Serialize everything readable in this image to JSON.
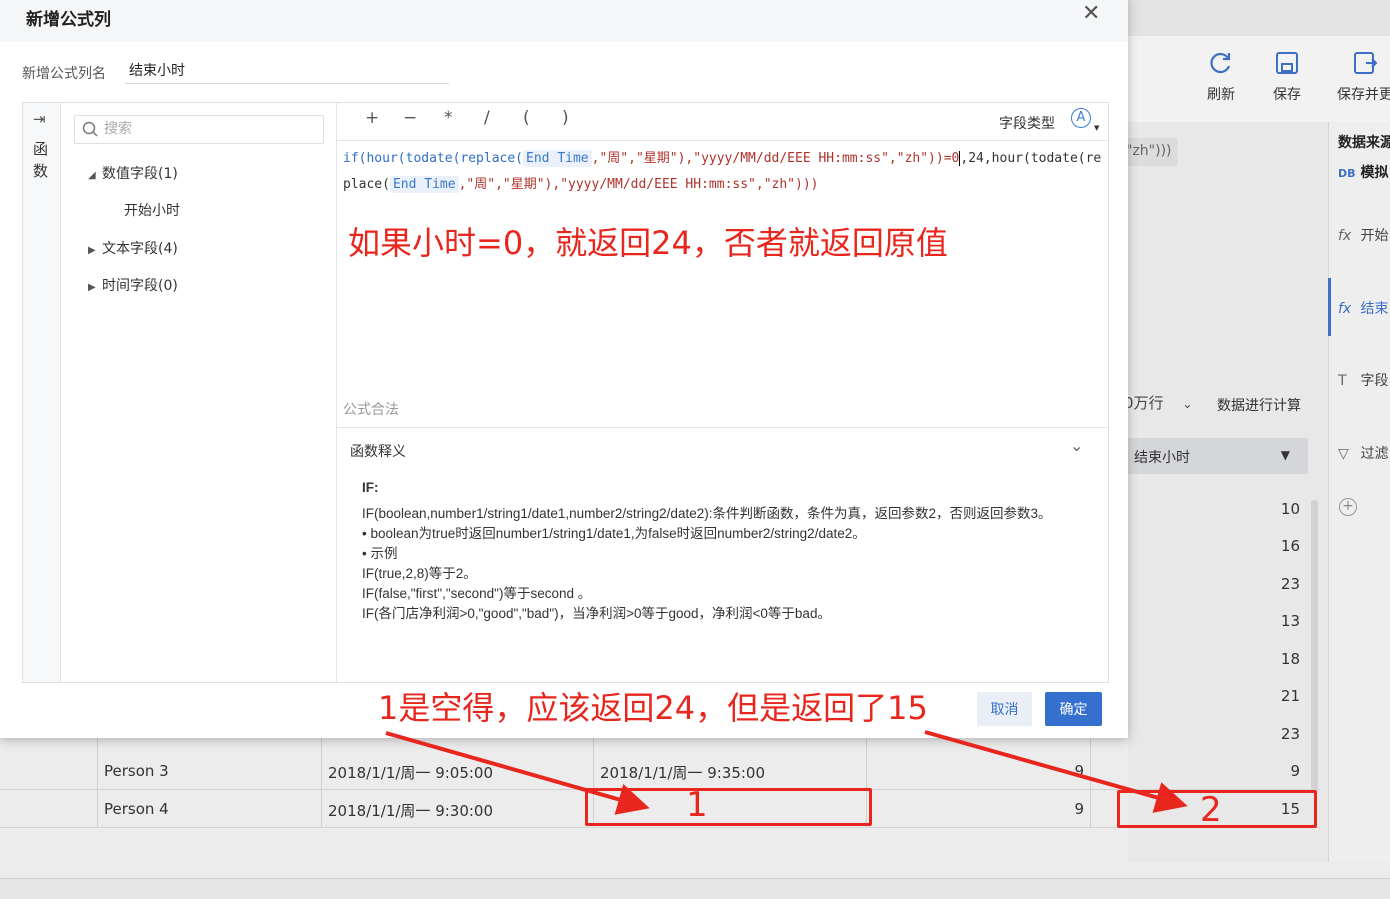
{
  "background": {
    "toolbar": {
      "refresh": "刷新",
      "save": "保存",
      "save_update": "保存并更"
    },
    "chip_text": "\"zh\")))",
    "right_panel": {
      "title": "数据来源",
      "db_badge": "DB",
      "db_label": "模拟",
      "items": [
        "开始",
        "结束",
        "字段",
        "过滤"
      ],
      "add": "+"
    },
    "limit_select": "0万行",
    "calc_label": "数据进行计算",
    "column_header": "结束小时",
    "right_values": [
      "10",
      "16",
      "23",
      "13",
      "18",
      "21",
      "23",
      "9",
      "15"
    ],
    "rows": [
      {
        "name": "Person 3",
        "start": "2018/1/1/周一 9:05:00",
        "end": "2018/1/1/周一 9:35:00",
        "hour": "9",
        "end_hour": "9"
      },
      {
        "name": "Person 4",
        "start": "2018/1/1/周一 9:30:00",
        "end": "",
        "hour": "9",
        "end_hour": "15"
      }
    ]
  },
  "dialog": {
    "title": "新增公式列",
    "close": "✕",
    "name_label": "新增公式列名",
    "name_value": "结束小时",
    "fn_toggle": "⇥",
    "fn_label": "函数",
    "search_placeholder": "搜索",
    "tree": {
      "numeric": "数值字段(1)",
      "numeric_child": "开始小时",
      "text": "文本字段(4)",
      "time": "时间字段(0)"
    },
    "operators": [
      "+",
      "−",
      "*",
      "/",
      "(",
      ")"
    ],
    "field_type_label": "字段类型",
    "field_type_icon": "A",
    "formula": {
      "p1": "if(hour(todate(replace(",
      "f1": "End Time",
      "p2": ",\"周\",\"星期\"),\"yyyy/MM/dd/EEE HH:mm:ss\",\"zh\"))=0",
      "p3": ",24,hour(todate(replace(",
      "f2": "End Time",
      "p4": ",\"周\",\"星期\"),\"yyyy/MM/dd/EEE HH:mm:ss\",\"zh\")))"
    },
    "status": "公式合法",
    "fn_desc_title": "函数释义",
    "fn_doc": {
      "name": "IF:",
      "lines": [
        "IF(boolean,number1/string1/date1,number2/string2/date2):条件判断函数，条件为真，返回参数2，否则返回参数3。",
        "• boolean为true时返回number1/string1/date1,为false时返回number2/string2/date2。",
        "• 示例",
        "IF(true,2,8)等于2。",
        "IF(false,\"first\",\"second\")等于second 。",
        "IF(各门店净利润>0,\"good\",\"bad\")，当净利润>0等于good，净利润<0等于bad。"
      ]
    },
    "cancel": "取消",
    "confirm": "确定"
  },
  "annotations": {
    "main": "如果小时=0，就返回24，否者就返回原值",
    "bottom": "1是空得，应该返回24，但是返回了15",
    "label1": "1",
    "label2": "2"
  },
  "colors": {
    "accent": "#3570cf",
    "annotation": "#e8261d"
  }
}
